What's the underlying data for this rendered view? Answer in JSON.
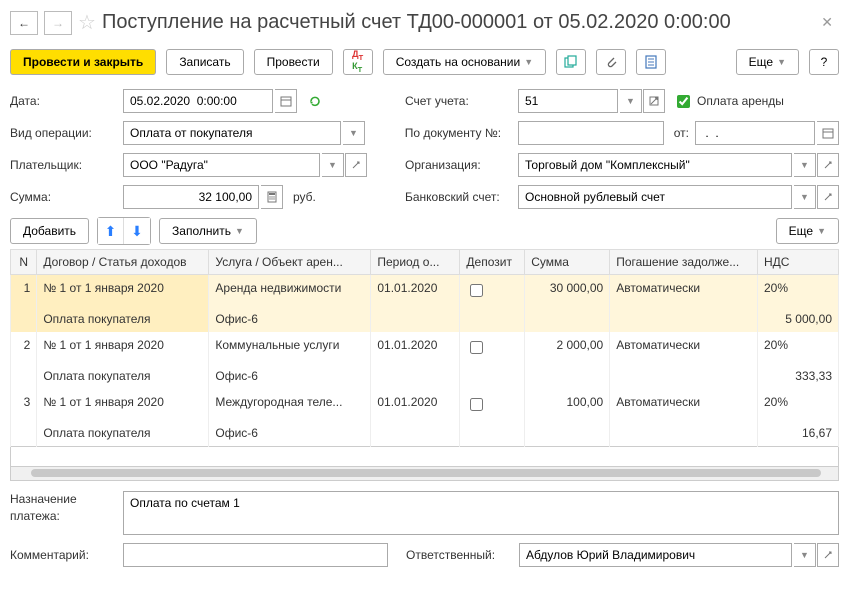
{
  "header": {
    "title": "Поступление на расчетный счет ТД00-000001 от 05.02.2020 0:00:00"
  },
  "toolbar": {
    "post_and_close": "Провести и закрыть",
    "save": "Записать",
    "post": "Провести",
    "create_based": "Создать на основании",
    "more": "Еще"
  },
  "form": {
    "date_label": "Дата:",
    "date_value": "05.02.2020  0:00:00",
    "operation_label": "Вид операции:",
    "operation_value": "Оплата от покупателя",
    "payer_label": "Плательщик:",
    "payer_value": "ООО \"Радуга\"",
    "sum_label": "Сумма:",
    "sum_value": "32 100,00",
    "currency": "руб.",
    "account_label": "Счет учета:",
    "account_value": "51",
    "rent_payment_label": "Оплата аренды",
    "doc_num_label": "По документу №:",
    "from_label": "от:",
    "from_value": " .  .    ",
    "org_label": "Организация:",
    "org_value": "Торговый дом \"Комплексный\"",
    "bank_label": "Банковский счет:",
    "bank_value": "Основной рублевый счет"
  },
  "table_toolbar": {
    "add": "Добавить",
    "fill": "Заполнить",
    "more": "Еще"
  },
  "columns": {
    "n": "N",
    "contract": "Договор / Статья доходов",
    "service": "Услуга / Объект арен...",
    "period": "Период о...",
    "deposit": "Депозит",
    "sum": "Сумма",
    "repay": "Погашение задолже...",
    "vat": "НДС"
  },
  "rows": [
    {
      "n": "1",
      "contract1": "№ 1 от 1 января 2020",
      "contract2": "Оплата покупателя",
      "service1": "Аренда недвижимости",
      "service2": "Офис-6",
      "period": "01.01.2020",
      "deposit": false,
      "sum": "30 000,00",
      "repay": "Автоматически",
      "vat1": "20%",
      "vat2": "5 000,00"
    },
    {
      "n": "2",
      "contract1": "№ 1 от 1 января 2020",
      "contract2": "Оплата покупателя",
      "service1": "Коммунальные услуги",
      "service2": "Офис-6",
      "period": "01.01.2020",
      "deposit": false,
      "sum": "2 000,00",
      "repay": "Автоматически",
      "vat1": "20%",
      "vat2": "333,33"
    },
    {
      "n": "3",
      "contract1": "№ 1 от 1 января 2020",
      "contract2": "Оплата покупателя",
      "service1": "Междугородная теле...",
      "service2": "Офис-6",
      "period": "01.01.2020",
      "deposit": false,
      "sum": "100,00",
      "repay": "Автоматически",
      "vat1": "20%",
      "vat2": "16,67"
    }
  ],
  "footer": {
    "purpose_label": "Назначение платежа:",
    "purpose_value": "Оплата по счетам 1",
    "comment_label": "Комментарий:",
    "responsible_label": "Ответственный:",
    "responsible_value": "Абдулов Юрий Владимирович"
  }
}
